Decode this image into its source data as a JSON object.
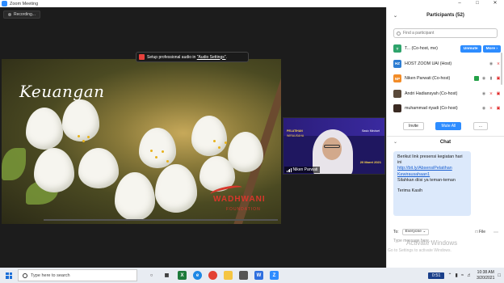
{
  "window": {
    "title": "Zoom Meeting",
    "controls": [
      "–",
      "□",
      "✕"
    ]
  },
  "meeting": {
    "recording_label": "Recording...",
    "audio_banner": {
      "prefix": "Setup professional audio in ",
      "link": "\"Audio Settings\"",
      "suffix": "."
    },
    "share": {
      "title": "Keuangan",
      "brand": "WADHWANI",
      "brand_sub": "FOUNDATION"
    },
    "camera": {
      "name": "Niken Parwati",
      "top_left_1": "PELATIHAN",
      "top_left_2": "WIRAUSAHA",
      "top_right": "Basic Mindset",
      "date_badge": "20 Maret 2021"
    }
  },
  "participants": {
    "header": "Participants (52)",
    "search_placeholder": "Find a participant",
    "list": [
      {
        "initial": "T",
        "color": "#2ea36b",
        "name": "T... (Co-host, me)",
        "buttons": [
          "Unmute",
          "More ›"
        ],
        "icons": []
      },
      {
        "initial": "HZ",
        "color": "#2d7dd2",
        "name": "HOST ZOOM UAI (Host)",
        "buttons": [],
        "icons": [
          "eye-icon",
          "mic-muted-icon"
        ]
      },
      {
        "initial": "NP",
        "color": "#f28c28",
        "name": "Niken Parwati (Co-host)",
        "buttons": [],
        "icons": [
          "share-icon",
          "eye-icon",
          "mic-icon",
          "video-muted-icon"
        ]
      },
      {
        "initial": "",
        "color": "#5a4a3a",
        "name": "Andri Hadiansyah (Co-host)",
        "buttons": [],
        "icons": [
          "eye-icon",
          "mic-muted-icon",
          "video-muted-icon"
        ]
      },
      {
        "initial": "",
        "color": "#3a2a22",
        "name": "muhammad riyadi (Co-host)",
        "buttons": [],
        "icons": [
          "eye-icon",
          "mic-muted-icon",
          "video-muted-icon"
        ]
      }
    ],
    "actions": {
      "invite": "Invite",
      "mute_all": "Mute All",
      "more": "..."
    }
  },
  "chat": {
    "header": "Chat",
    "message": {
      "line1": "Berikut link presensi kegiatan hari ini",
      "link": "http://bit.ly/AbsensiPelatihanKewirausahaan1",
      "link_display_1": "http://bit.ly/AbsensiPelatihan",
      "link_display_2": "Kewirausahaan1",
      "line2": "Silahkan diisi ya teman-teman",
      "line3": "Terima Kasih"
    },
    "to_label": "To:",
    "to_value": "Everyone",
    "file_label": "File",
    "input_placeholder": "Type message here..."
  },
  "watermark": {
    "line1": "Activate Windows",
    "line2": "Go to Settings to activate Windows."
  },
  "taskbar": {
    "search_placeholder": "Type here to search",
    "time_badge": "0:51",
    "time": "10:38 AM",
    "date": "3/20/2021"
  },
  "colors": {
    "zoom_blue": "#2d8cff",
    "muted_red": "#e02828",
    "chat_bubble": "#dce9fb"
  }
}
